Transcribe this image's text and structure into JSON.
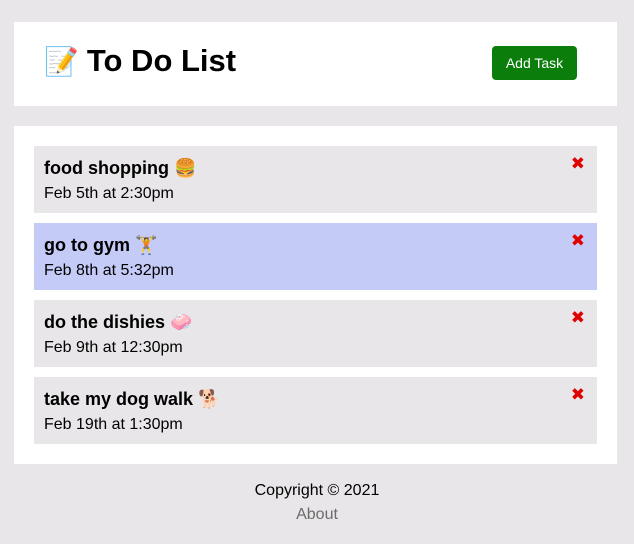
{
  "header": {
    "title_emoji": "📝",
    "title": "To Do List",
    "add_button_label": "Add Task",
    "add_button_color": "#0a7d0a"
  },
  "tasks": [
    {
      "text": "food shopping",
      "emoji": "🍔",
      "time": "Feb 5th at 2:30pm",
      "reminder": false,
      "delete_icon": "✖"
    },
    {
      "text": "go to gym",
      "emoji": "🏋",
      "time": "Feb 8th at 5:32pm",
      "reminder": true,
      "delete_icon": "✖"
    },
    {
      "text": "do the dishies",
      "emoji": "🧼",
      "time": "Feb 9th at 12:30pm",
      "reminder": false,
      "delete_icon": "✖"
    },
    {
      "text": "take my dog walk",
      "emoji": "🐕",
      "time": "Feb 19th at 1:30pm",
      "reminder": false,
      "delete_icon": "✖"
    }
  ],
  "colors": {
    "background": "#e8e6e8",
    "reminder_background": "#c5cbf7",
    "delete_color": "#e00000"
  },
  "footer": {
    "copyright": "Copyright © 2021",
    "about_link": "About"
  }
}
